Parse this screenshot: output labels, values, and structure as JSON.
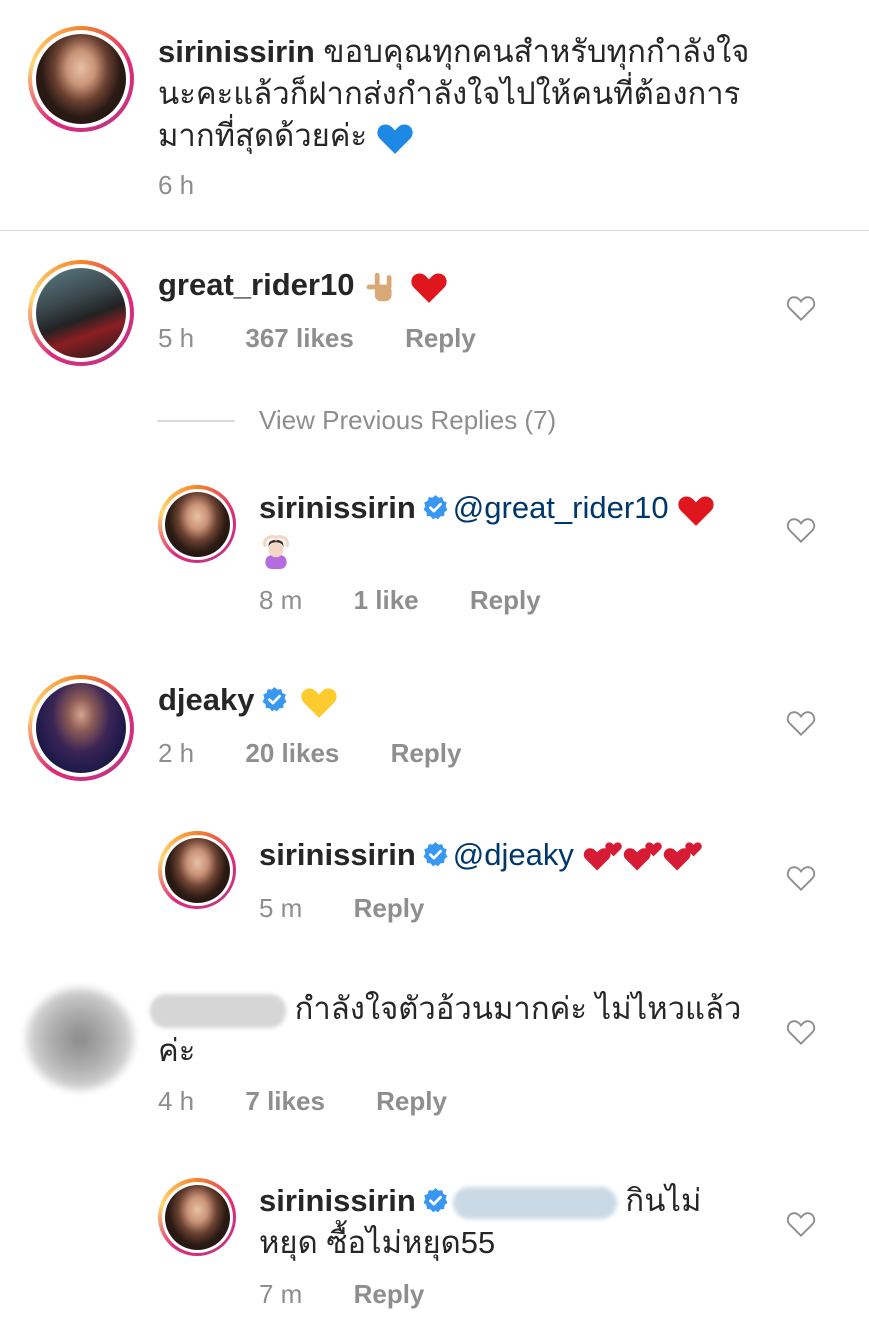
{
  "caption": {
    "username": "sirinissirin",
    "text": "ขอบคุณทุกคนสำหรับทุกกำลังใจนะคะแล้วก็ฝากส่งกำลังใจไปให้คนที่ต้องการมากที่สุดด้วยค่ะ",
    "line1_rest": "ขอบคุณทุกคนสำหรับทุกกำลังใจ",
    "line2": "นะคะแล้วก็ฝากส่งกำลังใจไปให้คนที่ต้องการ",
    "line3": "มากที่สุดด้วยค่ะ",
    "emoji": "blue-heart",
    "time": "6 h"
  },
  "comments": [
    {
      "username": "great_rider10",
      "emojis": [
        "love-you-gesture",
        "red-heart"
      ],
      "time": "5 h",
      "likes": "367 likes",
      "reply_label": "Reply",
      "view_previous": "View Previous Replies (7)",
      "replies": [
        {
          "username": "sirinissirin",
          "verified": true,
          "mention": "@great_rider10",
          "emojis": [
            "red-heart",
            "woman-gesturing-ok"
          ],
          "time": "8 m",
          "likes": "1 like",
          "reply_label": "Reply"
        }
      ]
    },
    {
      "username": "djeaky",
      "verified": true,
      "emojis": [
        "yellow-heart"
      ],
      "time": "2 h",
      "likes": "20 likes",
      "reply_label": "Reply",
      "replies": [
        {
          "username": "sirinissirin",
          "verified": true,
          "mention": "@djeaky",
          "emojis": [
            "two-hearts",
            "two-hearts",
            "two-hearts"
          ],
          "time": "5 m",
          "reply_label": "Reply"
        }
      ]
    },
    {
      "username_blurred": true,
      "line1": "กำลังใจตัวอ้วนมากค่ะ ไม่ไหวแล้ว",
      "line2": "ค่ะ",
      "time": "4 h",
      "likes": "7 likes",
      "reply_label": "Reply",
      "replies": [
        {
          "username": "sirinissirin",
          "verified": true,
          "mention_blurred": true,
          "line1": "กินไม่",
          "line2": "หยุด ซื้อไม่หยุด55",
          "time": "7 m",
          "reply_label": "Reply"
        }
      ]
    }
  ],
  "colors": {
    "text": "#262626",
    "meta": "#8e8e8e",
    "mention": "#00376b",
    "verified": "#3897f0",
    "divider": "#dbdbdb"
  }
}
